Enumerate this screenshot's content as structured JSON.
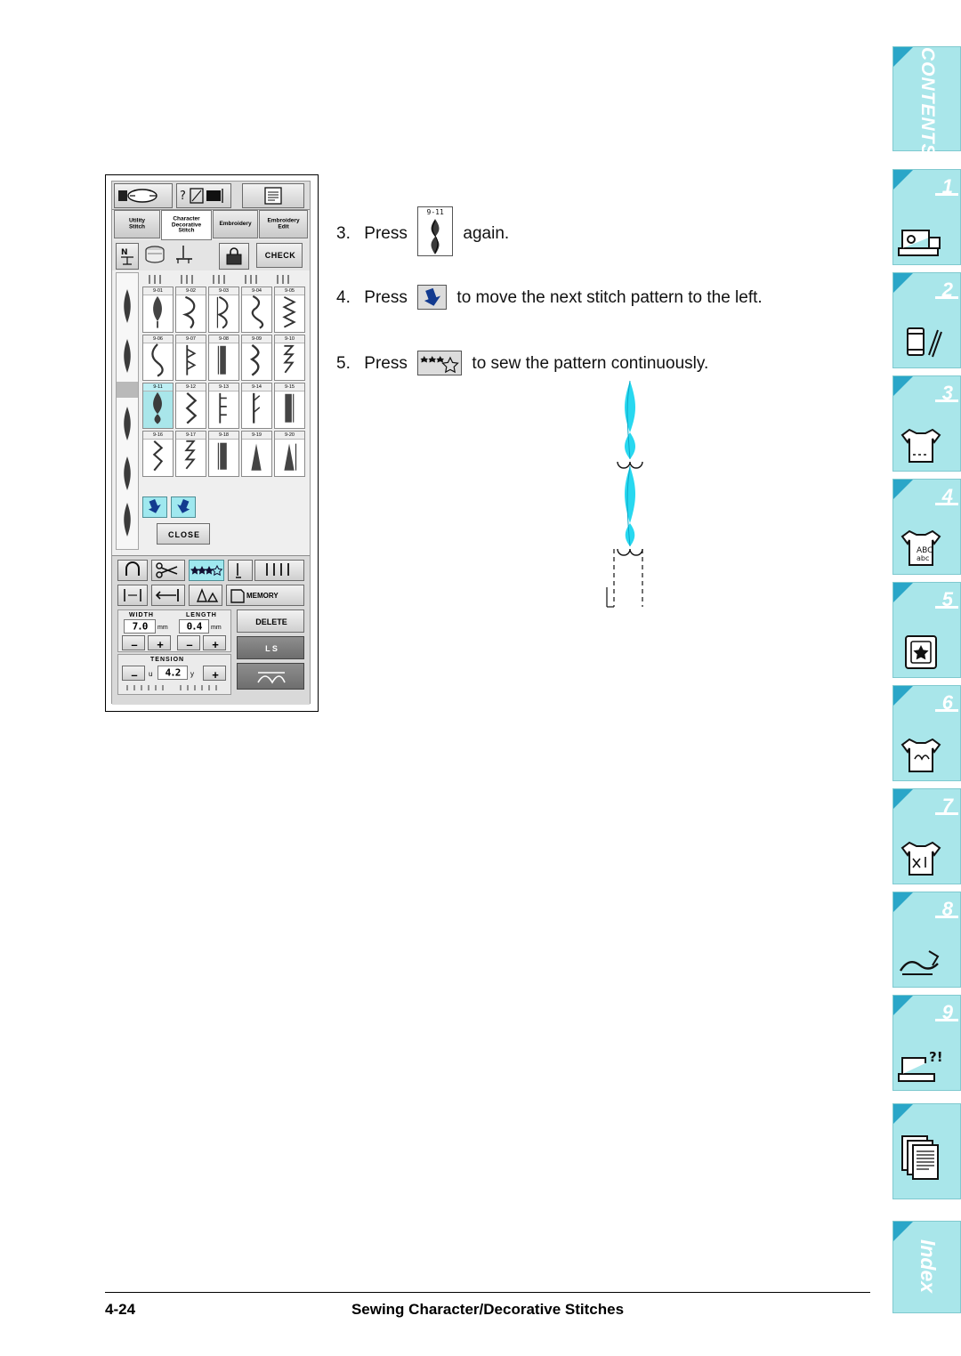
{
  "page": {
    "number": "4-24",
    "footer_title": "Sewing Character/Decorative Stitches"
  },
  "steps": [
    {
      "num": "3.",
      "pre": "Press",
      "key": "9-11",
      "post": "again."
    },
    {
      "num": "4.",
      "pre": "Press",
      "key": "arrow-down-left",
      "post": "to move the next stitch pattern to the left."
    },
    {
      "num": "5.",
      "pre": "Press",
      "key": "continuous-sew",
      "post": "to sew the pattern continuously."
    }
  ],
  "lcd": {
    "top_icons": [
      "thread-spool-icon",
      "needle-guide-icon",
      "page-icon"
    ],
    "tabs": [
      {
        "label": "Utility\nStitch",
        "selected": false
      },
      {
        "label": "Character\nDecorative\nStitch",
        "selected": true
      },
      {
        "label": "Embroidery",
        "selected": false
      },
      {
        "label": "Embroidery\nEdit",
        "selected": false
      }
    ],
    "toolbar": {
      "needle_mode_label": "N",
      "bobbin_icon": "bobbin-icon",
      "presser_icon": "presser-foot-icon",
      "lock_icon": "lock-icon",
      "check_label": "CHECK"
    },
    "stitch_grid": {
      "rows": [
        [
          "9-01",
          "9-02",
          "9-03",
          "9-04",
          "9-05"
        ],
        [
          "9-06",
          "9-07",
          "9-08",
          "9-09",
          "9-10"
        ],
        [
          "9-11",
          "9-12",
          "9-13",
          "9-14",
          "9-15"
        ],
        [
          "9-16",
          "9-17",
          "9-18",
          "9-19",
          "9-20"
        ]
      ],
      "selected": "9-11"
    },
    "nav": {
      "left_label": "arrow-down-left-icon",
      "right_label": "arrow-down-right-icon",
      "close_label": "CLOSE"
    },
    "function_row_1": [
      "reverse-stitch-icon",
      "thread-cutter-icon",
      "continuous-sew-icon",
      "single-needle-icon",
      "twin-needle-icon"
    ],
    "function_row_2": [
      "mirror-icon",
      "elongation-icon",
      "size-icon",
      "memory-icon"
    ],
    "memory_label": "MEMORY",
    "delete_label": "DELETE",
    "ls_label": "L  S",
    "settings": {
      "width_label": "WIDTH",
      "width_value": "7.0",
      "width_unit": "mm",
      "length_label": "LENGTH",
      "length_value": "0.4",
      "length_unit": "mm",
      "tension_label": "TENSION",
      "tension_value": "4.2",
      "tension_left": "u",
      "tension_right": "y",
      "minus": "–",
      "plus": "+"
    }
  },
  "sidebar": {
    "contents_label": "CONTENTS",
    "index_label": "Index",
    "tabs": [
      {
        "num": "1",
        "icon": "sewing-machine-icon"
      },
      {
        "num": "2",
        "icon": "spool-and-needles-icon"
      },
      {
        "num": "3",
        "icon": "tshirt-icon"
      },
      {
        "num": "4",
        "icon": "tshirt-abc-icon"
      },
      {
        "num": "5",
        "icon": "embroidery-hoop-icon"
      },
      {
        "num": "6",
        "icon": "tshirt-embroidery-icon"
      },
      {
        "num": "7",
        "icon": "tshirt-edit-icon"
      },
      {
        "num": "8",
        "icon": "appliqué-icon"
      },
      {
        "num": "9",
        "icon": "troubleshooting-icon"
      },
      {
        "num": "",
        "icon": "pages-icon"
      }
    ]
  },
  "colors": {
    "accent_cyan": "#00c8e8",
    "tab_bg": "#a9e6ea",
    "tab_corner": "#2aa6c8"
  }
}
